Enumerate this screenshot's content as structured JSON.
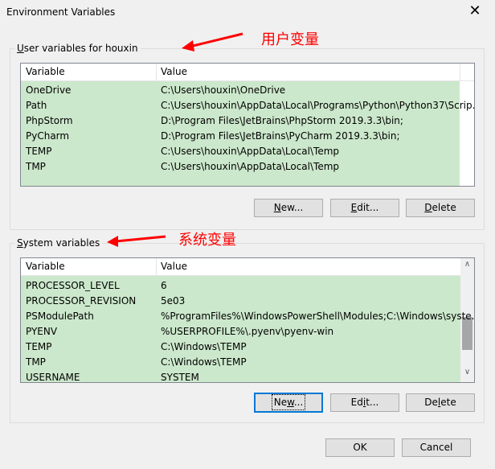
{
  "window": {
    "title": "Environment Variables",
    "close_glyph": "✕"
  },
  "user_group": {
    "legend_prefix": "U",
    "legend_rest": "ser variables for houxin",
    "annotation": "用户变量",
    "headers": {
      "variable": "Variable",
      "value": "Value"
    },
    "rows": [
      {
        "name": "OneDrive",
        "value": "C:\\Users\\houxin\\OneDrive"
      },
      {
        "name": "Path",
        "value": "C:\\Users\\houxin\\AppData\\Local\\Programs\\Python\\Python37\\Scrip..."
      },
      {
        "name": "PhpStorm",
        "value": "D:\\Program Files\\JetBrains\\PhpStorm 2019.3.3\\bin;"
      },
      {
        "name": "PyCharm",
        "value": "D:\\Program Files\\JetBrains\\PyCharm 2019.3.3\\bin;"
      },
      {
        "name": "TEMP",
        "value": "C:\\Users\\houxin\\AppData\\Local\\Temp"
      },
      {
        "name": "TMP",
        "value": "C:\\Users\\houxin\\AppData\\Local\\Temp"
      }
    ],
    "buttons": {
      "new_prefix": "N",
      "new_rest": "ew...",
      "edit_prefix": "E",
      "edit_rest": "dit...",
      "delete_prefix": "D",
      "delete_rest": "elete"
    }
  },
  "system_group": {
    "legend_prefix": "S",
    "legend_rest": "ystem variables",
    "annotation": "系统变量",
    "headers": {
      "variable": "Variable",
      "value": "Value"
    },
    "rows": [
      {
        "name": "PROCESSOR_LEVEL",
        "value": "6"
      },
      {
        "name": "PROCESSOR_REVISION",
        "value": "5e03"
      },
      {
        "name": "PSModulePath",
        "value": "%ProgramFiles%\\WindowsPowerShell\\Modules;C:\\Windows\\syste..."
      },
      {
        "name": "PYENV",
        "value": "%USERPROFILE%\\.pyenv\\pyenv-win"
      },
      {
        "name": "TEMP",
        "value": "C:\\Windows\\TEMP"
      },
      {
        "name": "TMP",
        "value": "C:\\Windows\\TEMP"
      },
      {
        "name": "USERNAME",
        "value": "SYSTEM"
      }
    ],
    "buttons": {
      "new_prefix": "Ne",
      "new_mid": "w",
      "new_rest": "...",
      "edit_prefix": "Ed",
      "edit_mid": "i",
      "edit_rest": "t...",
      "delete_prefix": "De",
      "delete_mid": "l",
      "delete_rest": "ete"
    }
  },
  "footer": {
    "ok": "OK",
    "cancel": "Cancel"
  },
  "colors": {
    "row_bg": "#cce8cc",
    "annotation": "#ff0000",
    "focus": "#0078d7"
  },
  "scrollbar": {
    "up_glyph": "∧",
    "down_glyph": "∨"
  }
}
